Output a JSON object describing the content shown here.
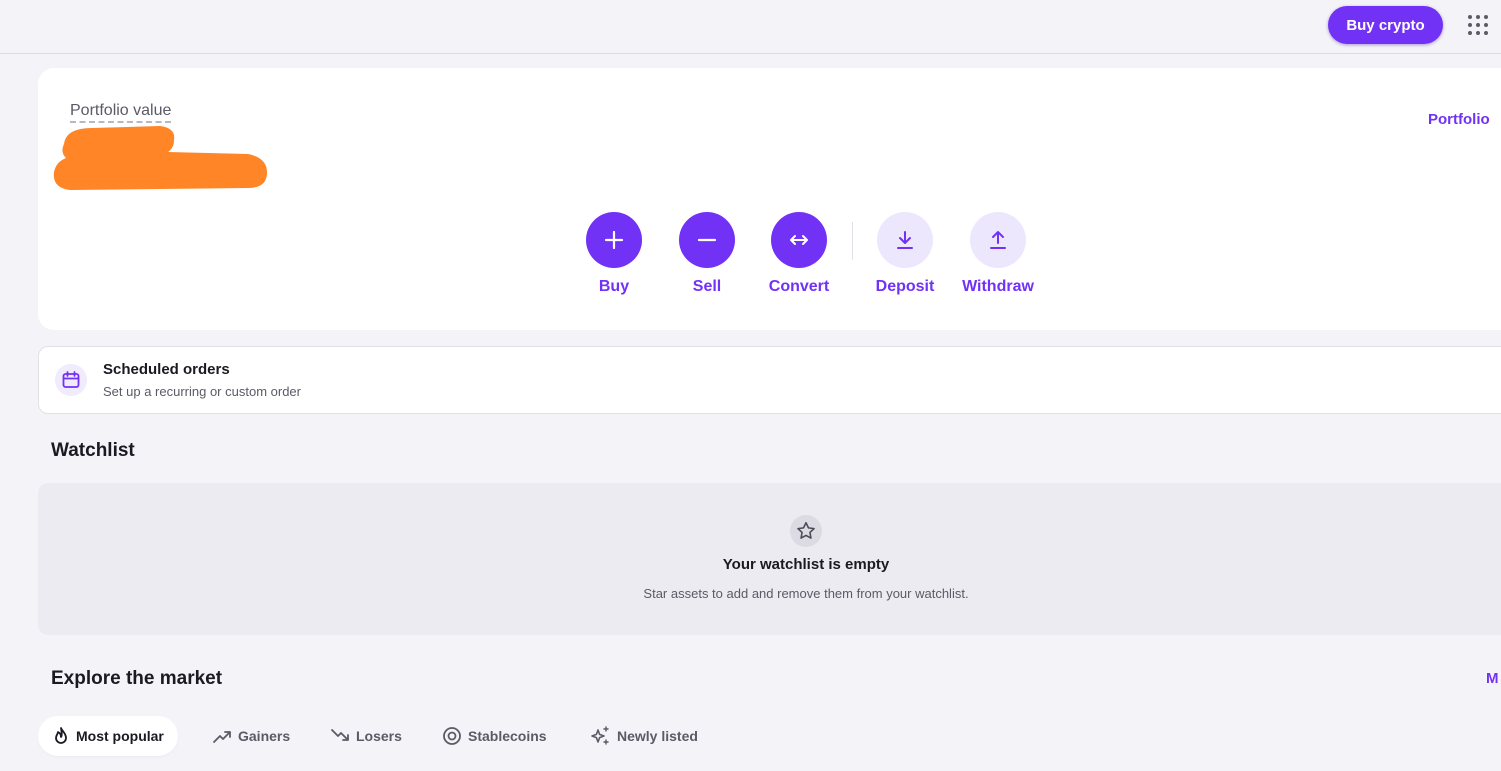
{
  "header": {
    "buy_crypto_label": "Buy crypto",
    "apps_icon": "grid-dots-icon"
  },
  "portfolio": {
    "value_label": "Portfolio value",
    "value": "",
    "value_redacted": true,
    "redaction_color": "#ff8527",
    "link_label": "Portfolio",
    "actions": [
      {
        "label": "Buy",
        "icon": "plus-icon"
      },
      {
        "label": "Sell",
        "icon": "minus-icon"
      },
      {
        "label": "Convert",
        "icon": "arrows-horizontal-icon"
      },
      {
        "label": "Deposit",
        "icon": "download-icon"
      },
      {
        "label": "Withdraw",
        "icon": "upload-icon"
      }
    ]
  },
  "scheduled_orders": {
    "title": "Scheduled orders",
    "subtitle": "Set up a recurring or custom order",
    "icon": "calendar-icon"
  },
  "watchlist": {
    "title": "Watchlist",
    "empty_title": "Your watchlist is empty",
    "empty_subtitle": "Star assets to add and remove them from your watchlist.",
    "icon": "star-icon"
  },
  "market": {
    "title": "Explore the market",
    "more_label": "M",
    "tabs": [
      {
        "label": "Most popular",
        "icon": "flame-icon",
        "active": true
      },
      {
        "label": "Gainers",
        "icon": "trend-up-icon",
        "active": false
      },
      {
        "label": "Losers",
        "icon": "trend-down-icon",
        "active": false
      },
      {
        "label": "Stablecoins",
        "icon": "stablecoin-icon",
        "active": false
      },
      {
        "label": "Newly listed",
        "icon": "sparkles-icon",
        "active": false
      }
    ]
  },
  "colors": {
    "accent": "#7132f5",
    "accent_light": "#ece7fd",
    "background": "#f4f3f8",
    "card": "#ffffff"
  }
}
